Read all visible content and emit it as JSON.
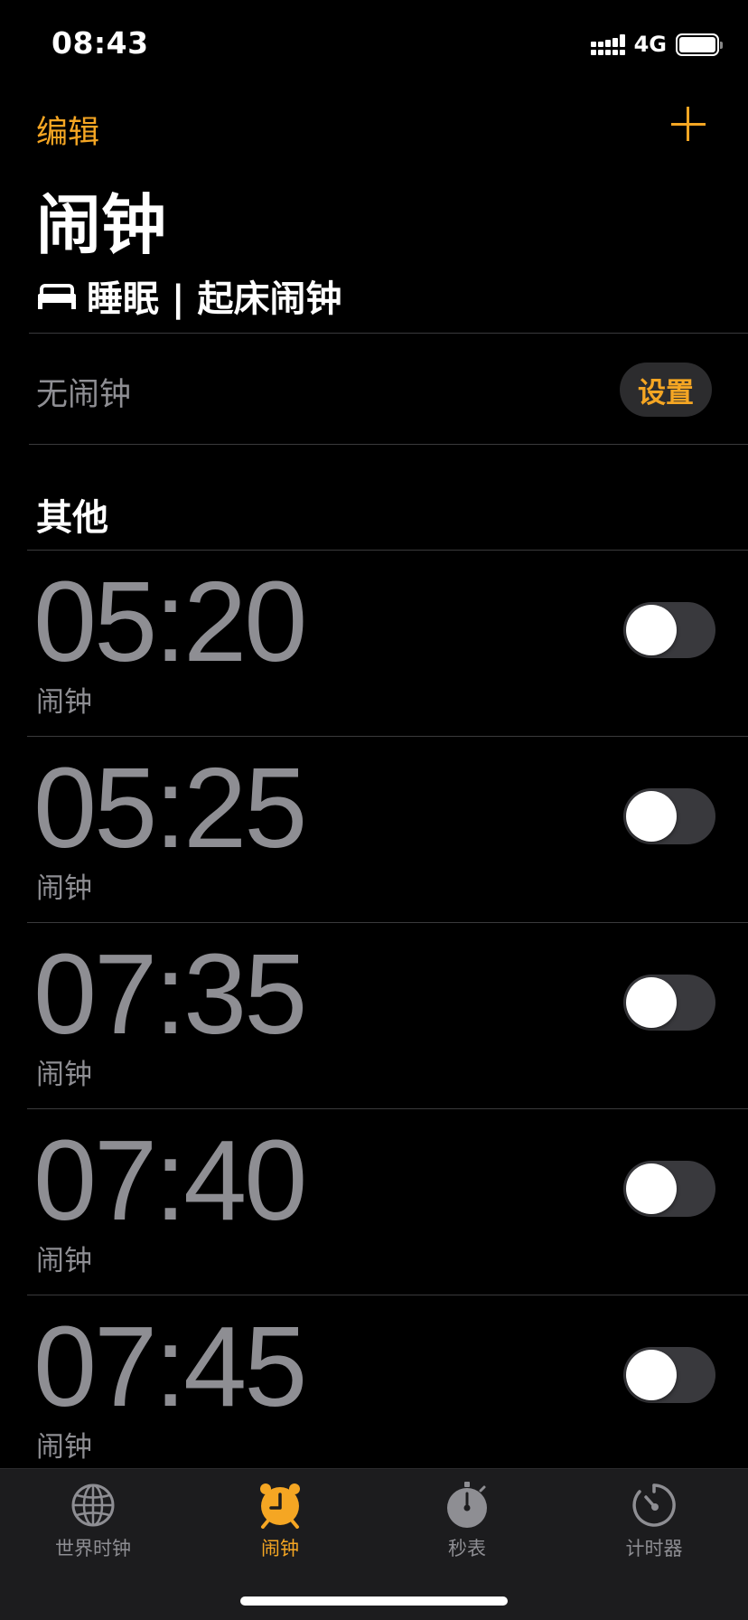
{
  "status_bar": {
    "time": "08:43",
    "network": "4G",
    "icons": [
      "signal-icon",
      "battery-icon"
    ]
  },
  "header": {
    "edit_label": "编辑",
    "add_icon": "plus-icon",
    "title": "闹钟"
  },
  "sleep": {
    "icon": "bed-icon",
    "title": "睡眠 | 起床闹钟",
    "status": "无闹钟",
    "setup_label": "设置"
  },
  "other": {
    "title": "其他"
  },
  "alarms": [
    {
      "time": "05:20",
      "label": "闹钟",
      "enabled": false
    },
    {
      "time": "05:25",
      "label": "闹钟",
      "enabled": false
    },
    {
      "time": "07:35",
      "label": "闹钟",
      "enabled": false
    },
    {
      "time": "07:40",
      "label": "闹钟",
      "enabled": false
    },
    {
      "time": "07:45",
      "label": "闹钟",
      "enabled": false
    }
  ],
  "tabs": [
    {
      "label": "世界时钟",
      "icon": "globe-icon",
      "active": false
    },
    {
      "label": "闹钟",
      "icon": "alarm-clock-icon",
      "active": true
    },
    {
      "label": "秒表",
      "icon": "stopwatch-icon",
      "active": false
    },
    {
      "label": "计时器",
      "icon": "timer-icon",
      "active": false
    }
  ],
  "colors": {
    "accent": "#f5a623",
    "background": "#000000",
    "secondary_text": "#8e8e93",
    "tab_bar": "#1c1c1e"
  }
}
